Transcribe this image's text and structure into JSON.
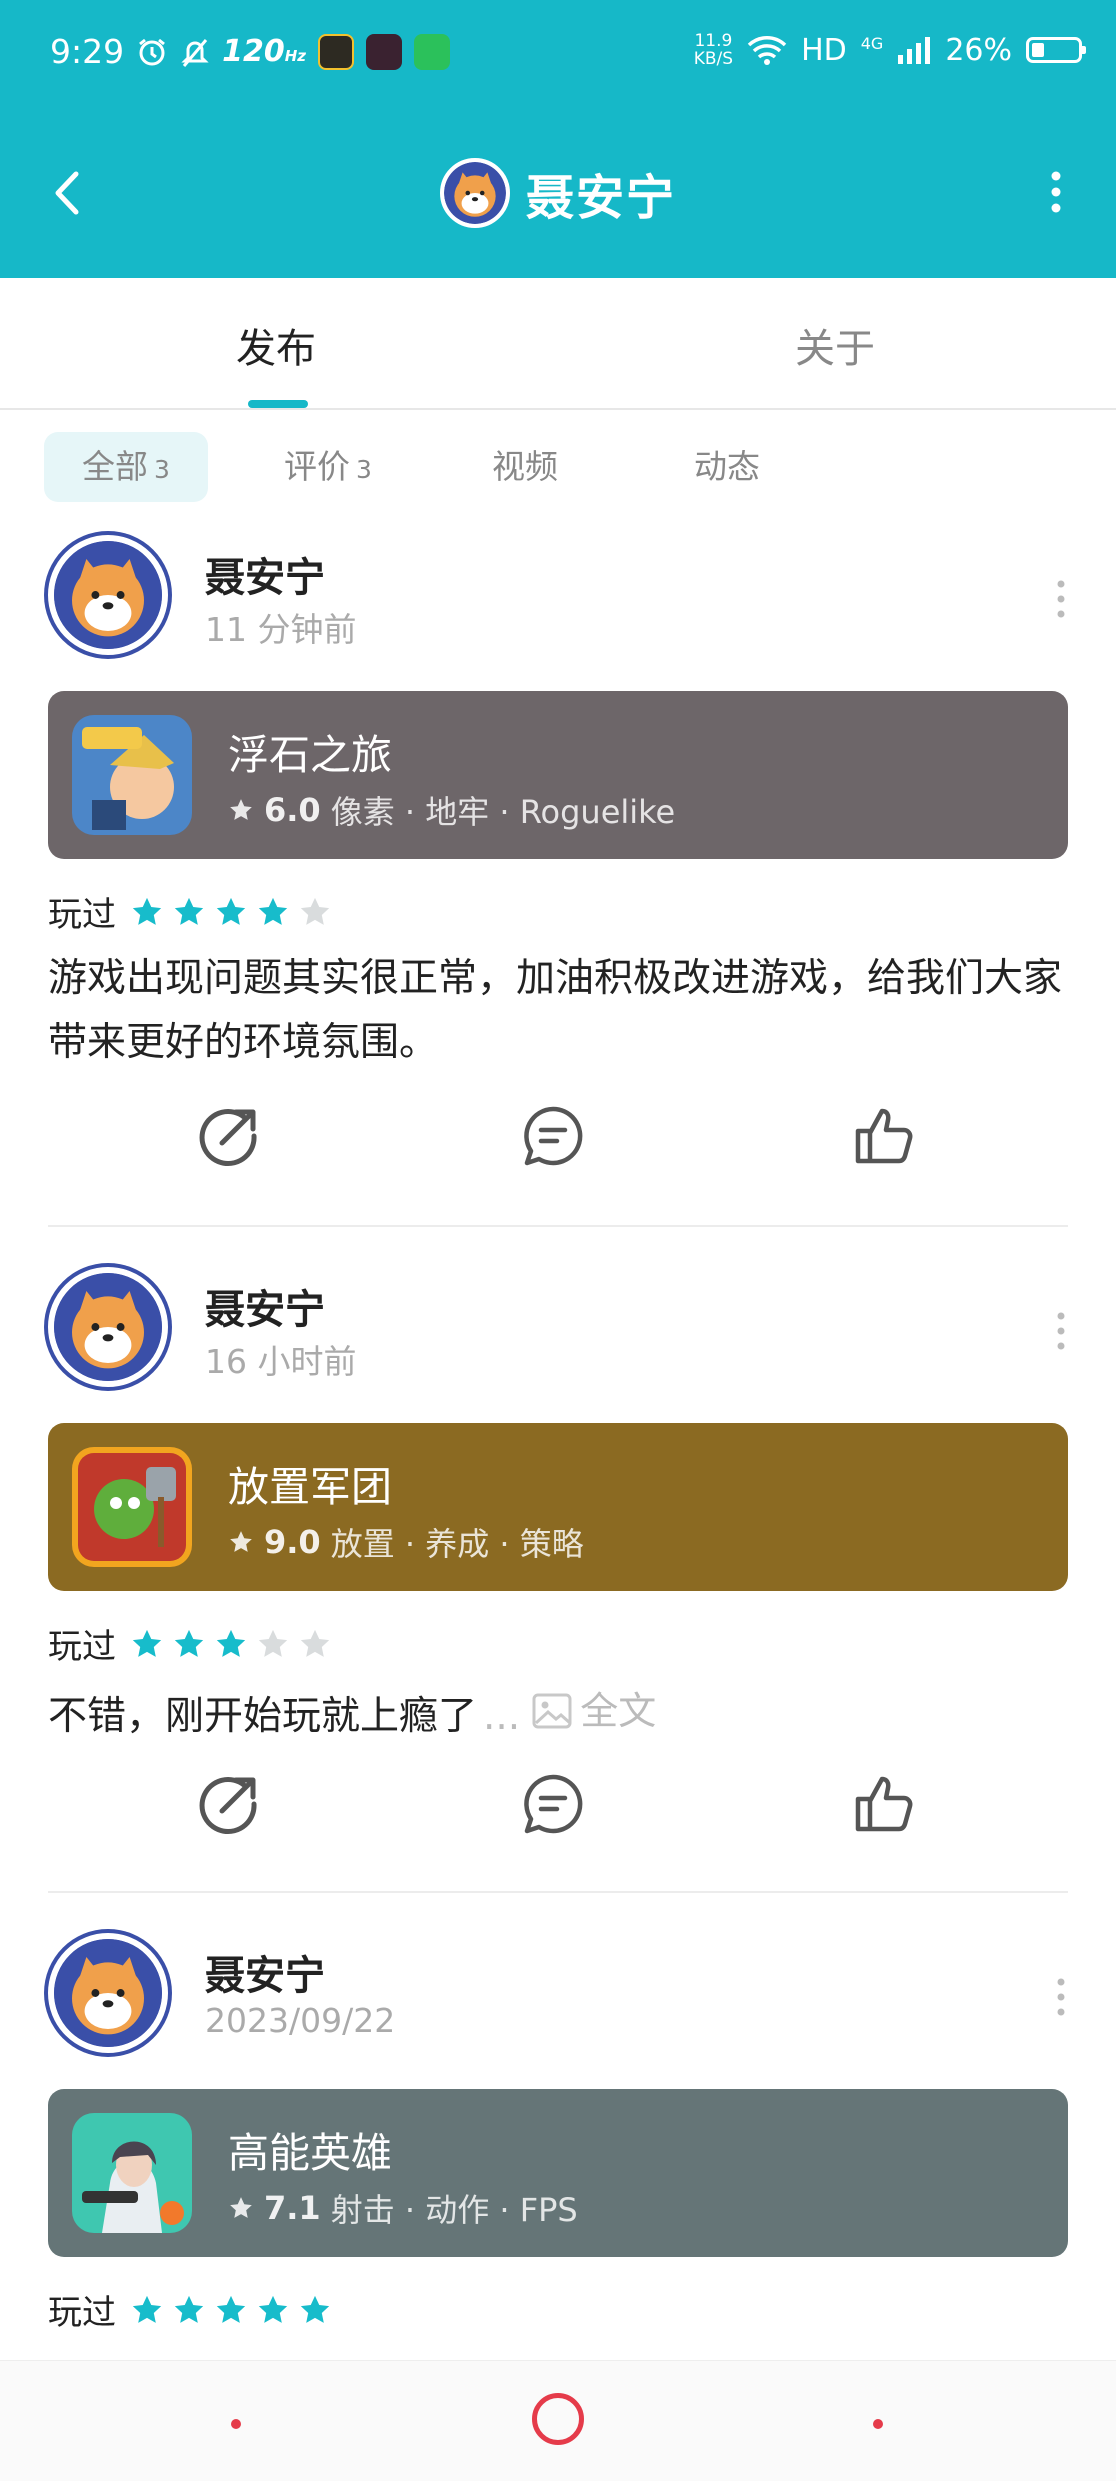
{
  "status_bar": {
    "time": "9:29",
    "refresh_rate": "120",
    "refresh_unit": "Hz",
    "speed_value": "11.9",
    "speed_unit": "KB/S",
    "hd": "HD",
    "network": "4G",
    "battery": "26%",
    "battery_level": 0.26
  },
  "header": {
    "title": "聂安宁",
    "back_icon": "chevron-left-icon",
    "more_icon": "more-vertical-icon"
  },
  "tabs": [
    {
      "label": "发布",
      "active": true
    },
    {
      "label": "关于",
      "active": false
    }
  ],
  "filters": [
    {
      "label": "全部",
      "count": "3",
      "selected": true
    },
    {
      "label": "评价",
      "count": "3",
      "selected": false
    },
    {
      "label": "视频",
      "count": "",
      "selected": false
    },
    {
      "label": "动态",
      "count": "",
      "selected": false
    }
  ],
  "posts": [
    {
      "user": "聂安宁",
      "time": "11 分钟前",
      "game": {
        "name": "浮石之旅",
        "score": "6.0",
        "tags": "像素 · 地牢 · Roguelike",
        "card_color": "#6d6669"
      },
      "played_label": "玩过",
      "rating": 4,
      "content": "游戏出现问题其实很正常，加油积极改进游戏，给我们大家带来更好的环境氛围。",
      "truncated": false
    },
    {
      "user": "聂安宁",
      "time": "16 小时前",
      "game": {
        "name": "放置军团",
        "score": "9.0",
        "tags": "放置 · 养成 · 策略",
        "card_color": "#8b6a22"
      },
      "played_label": "玩过",
      "rating": 3,
      "content": "不错，刚开始玩就上瘾了",
      "truncated": true,
      "ellipsis": "...",
      "full_text_label": "全文"
    },
    {
      "user": "聂安宁",
      "time": "2023/09/22",
      "game": {
        "name": "高能英雄",
        "score": "7.1",
        "tags": "射击 · 动作 · FPS",
        "card_color": "#657577"
      },
      "played_label": "玩过",
      "rating": 5
    }
  ],
  "colors": {
    "accent": "#16b8c8",
    "star_on": "#17bccb",
    "star_off": "#d9dcdd",
    "nav_red": "#e53b4a"
  }
}
